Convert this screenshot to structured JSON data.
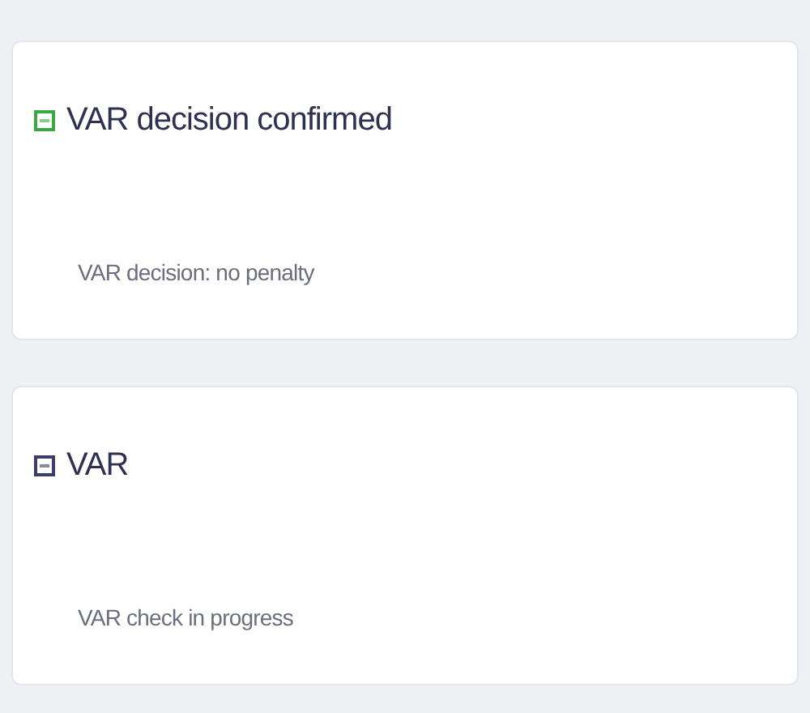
{
  "events": [
    {
      "title": "VAR decision confirmed",
      "description": "VAR decision: no penalty",
      "color": "#3aa845"
    },
    {
      "title": "VAR",
      "description": "VAR check in progress",
      "color": "#3b3d6b"
    }
  ]
}
